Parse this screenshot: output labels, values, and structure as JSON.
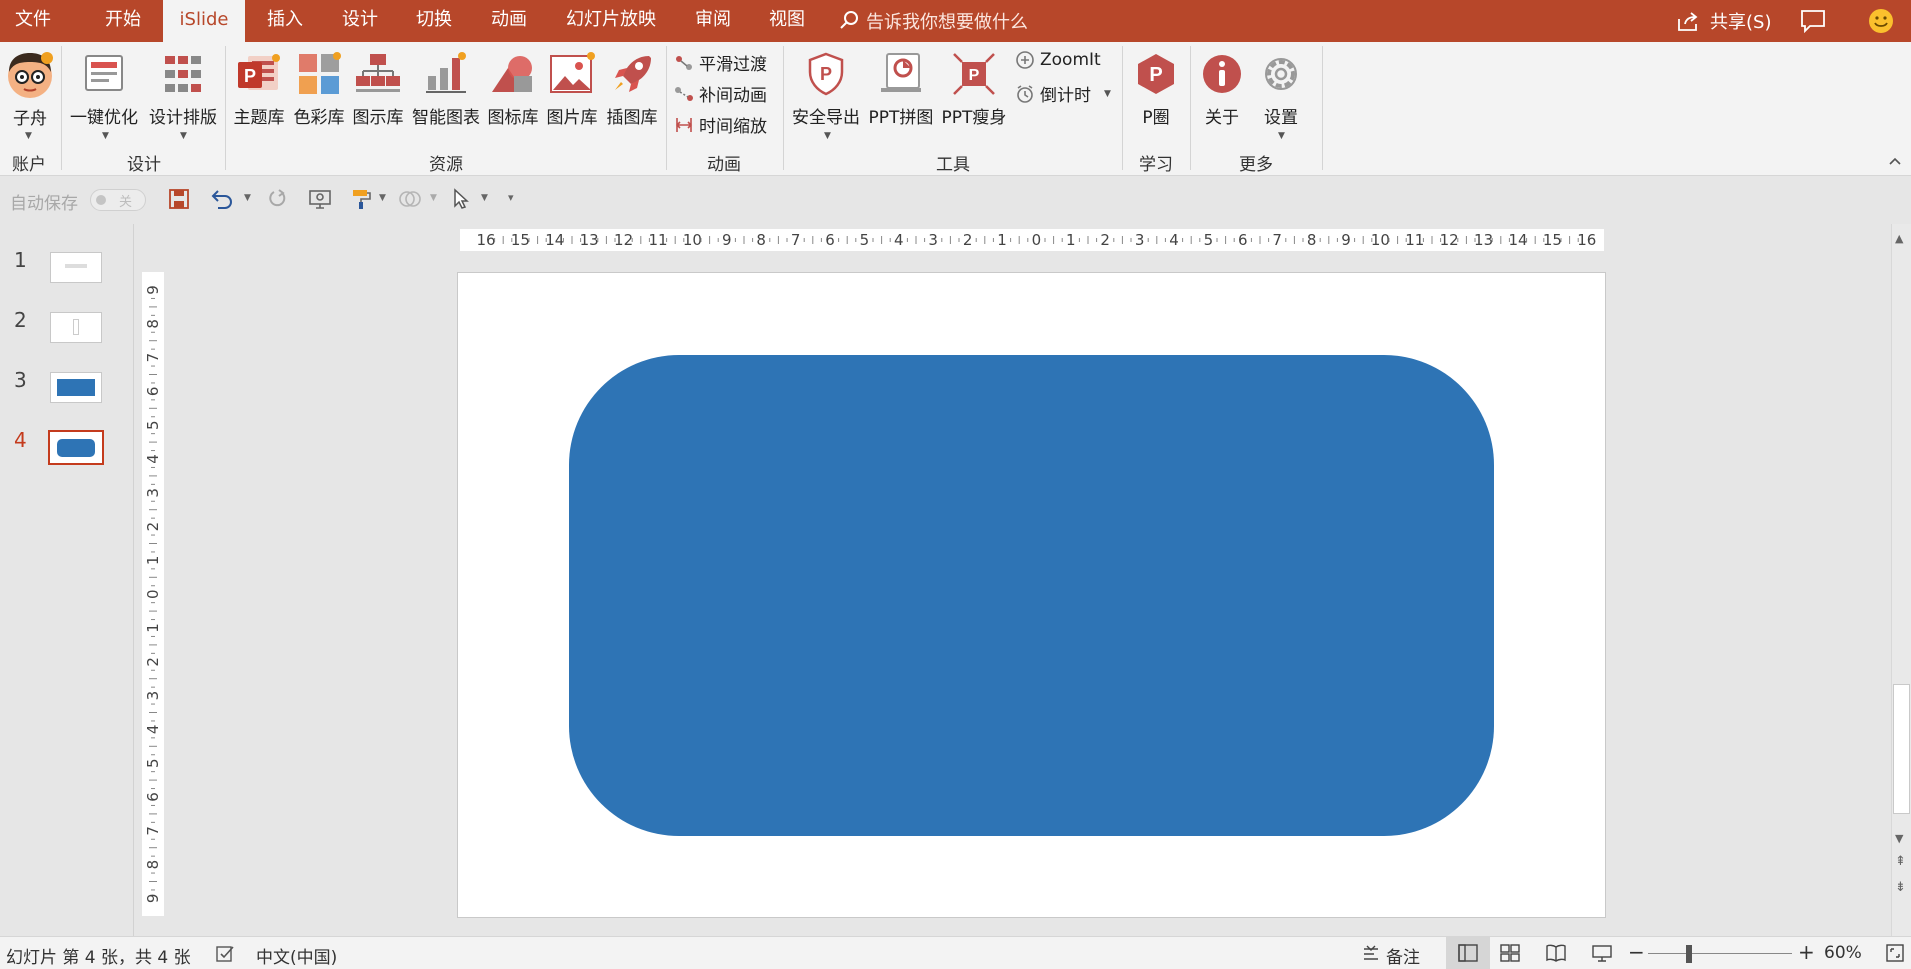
{
  "menu": {
    "tabs": [
      "文件",
      "开始",
      "iSlide",
      "插入",
      "设计",
      "切换",
      "动画",
      "幻灯片放映",
      "审阅",
      "视图"
    ],
    "search_placeholder": "告诉我你想要做什么",
    "share_label": "共享(S)"
  },
  "ribbon": {
    "account": {
      "label": "子舟",
      "group": "账户"
    },
    "design": {
      "one_click": "一键优化",
      "layout": "设计排版",
      "group": "设计"
    },
    "resources": {
      "items": [
        "主题库",
        "色彩库",
        "图示库",
        "智能图表",
        "图标库",
        "图片库",
        "插图库"
      ],
      "group": "资源"
    },
    "animation": {
      "items": [
        "平滑过渡",
        "补间动画",
        "时间缩放"
      ],
      "group": "动画"
    },
    "tools": {
      "export": "安全导出",
      "collage": "PPT拼图",
      "slim": "PPT瘦身",
      "zoomit": "ZoomIt",
      "countdown": "倒计时",
      "group": "工具"
    },
    "learn": {
      "label": "P圈",
      "group": "学习"
    },
    "more": {
      "about": "关于",
      "settings": "设置",
      "group": "更多"
    }
  },
  "qat": {
    "autosave_label": "自动保存",
    "autosave_state": "关"
  },
  "thumbnails": {
    "numbers": [
      "1",
      "2",
      "3",
      "4"
    ],
    "active_index": 4
  },
  "ruler": {
    "horizontal": [
      "16",
      "15",
      "14",
      "13",
      "12",
      "11",
      "10",
      "9",
      "8",
      "7",
      "6",
      "5",
      "4",
      "3",
      "2",
      "1",
      "0",
      "1",
      "2",
      "3",
      "4",
      "5",
      "6",
      "7",
      "8",
      "9",
      "10",
      "11",
      "12",
      "13",
      "14",
      "15",
      "16"
    ],
    "vertical": [
      "9",
      "8",
      "7",
      "6",
      "5",
      "4",
      "3",
      "2",
      "1",
      "0",
      "1",
      "2",
      "3",
      "4",
      "5",
      "6",
      "7",
      "8",
      "9"
    ]
  },
  "slide": {
    "shape_color": "#2e74b5"
  },
  "status": {
    "slide_info": "幻灯片 第 4 张，共 4 张",
    "language": "中文(中国)",
    "notes_label": "备注",
    "zoom_level": "60%"
  },
  "colors": {
    "accent": "#b7472a",
    "shape": "#2e74b5"
  }
}
